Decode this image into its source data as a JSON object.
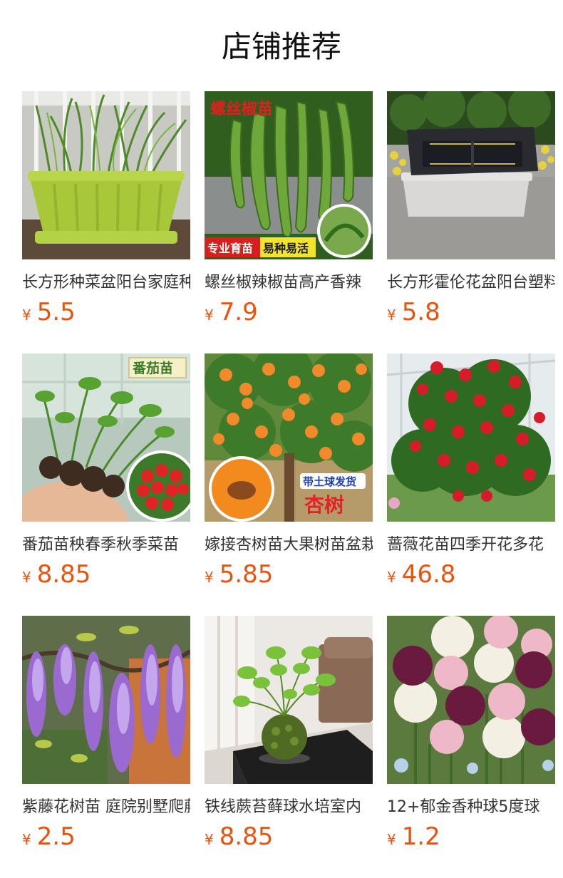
{
  "page": {
    "title": "店铺推荐"
  },
  "colors": {
    "price": "#e8530e",
    "title_text": "#111111",
    "product_text": "#333333"
  },
  "products": [
    {
      "title": "长方形种菜盆阳台家庭种植箱",
      "currency": "¥",
      "price": "5.5",
      "image_icon": "green-planter-image"
    },
    {
      "title": "螺丝椒辣椒苗高产香辣",
      "currency": "¥",
      "price": "7.9",
      "image_icon": "pepper-seedling-image",
      "image_text": {
        "banner": "螺丝椒苗",
        "tag_left": "专业育苗",
        "tag_right": "易种易活"
      }
    },
    {
      "title": "长方形霍伦花盆阳台塑料",
      "currency": "¥",
      "price": "5.8",
      "image_icon": "gray-planter-image"
    },
    {
      "title": "番茄苗秧春季秋季菜苗",
      "currency": "¥",
      "price": "8.85",
      "image_icon": "tomato-seedling-image",
      "image_text": {
        "badge": "番茄苗"
      }
    },
    {
      "title": "嫁接杏树苗大果树苗盆栽",
      "currency": "¥",
      "price": "5.85",
      "image_icon": "apricot-tree-image",
      "image_text": {
        "tag": "带土球发货",
        "label": "杏树"
      }
    },
    {
      "title": "蔷薇花苗四季开花多花",
      "currency": "¥",
      "price": "46.8",
      "image_icon": "rose-bush-image"
    },
    {
      "title": "紫藤花树苗 庭院别墅爬藤",
      "currency": "¥",
      "price": "2.5",
      "image_icon": "wisteria-image"
    },
    {
      "title": "铁线蕨苔藓球水培室内",
      "currency": "¥",
      "price": "8.85",
      "image_icon": "fern-moss-ball-image"
    },
    {
      "title": "12+郁金香种球5度球",
      "currency": "¥",
      "price": "1.2",
      "image_icon": "tulip-bulbs-image"
    }
  ]
}
